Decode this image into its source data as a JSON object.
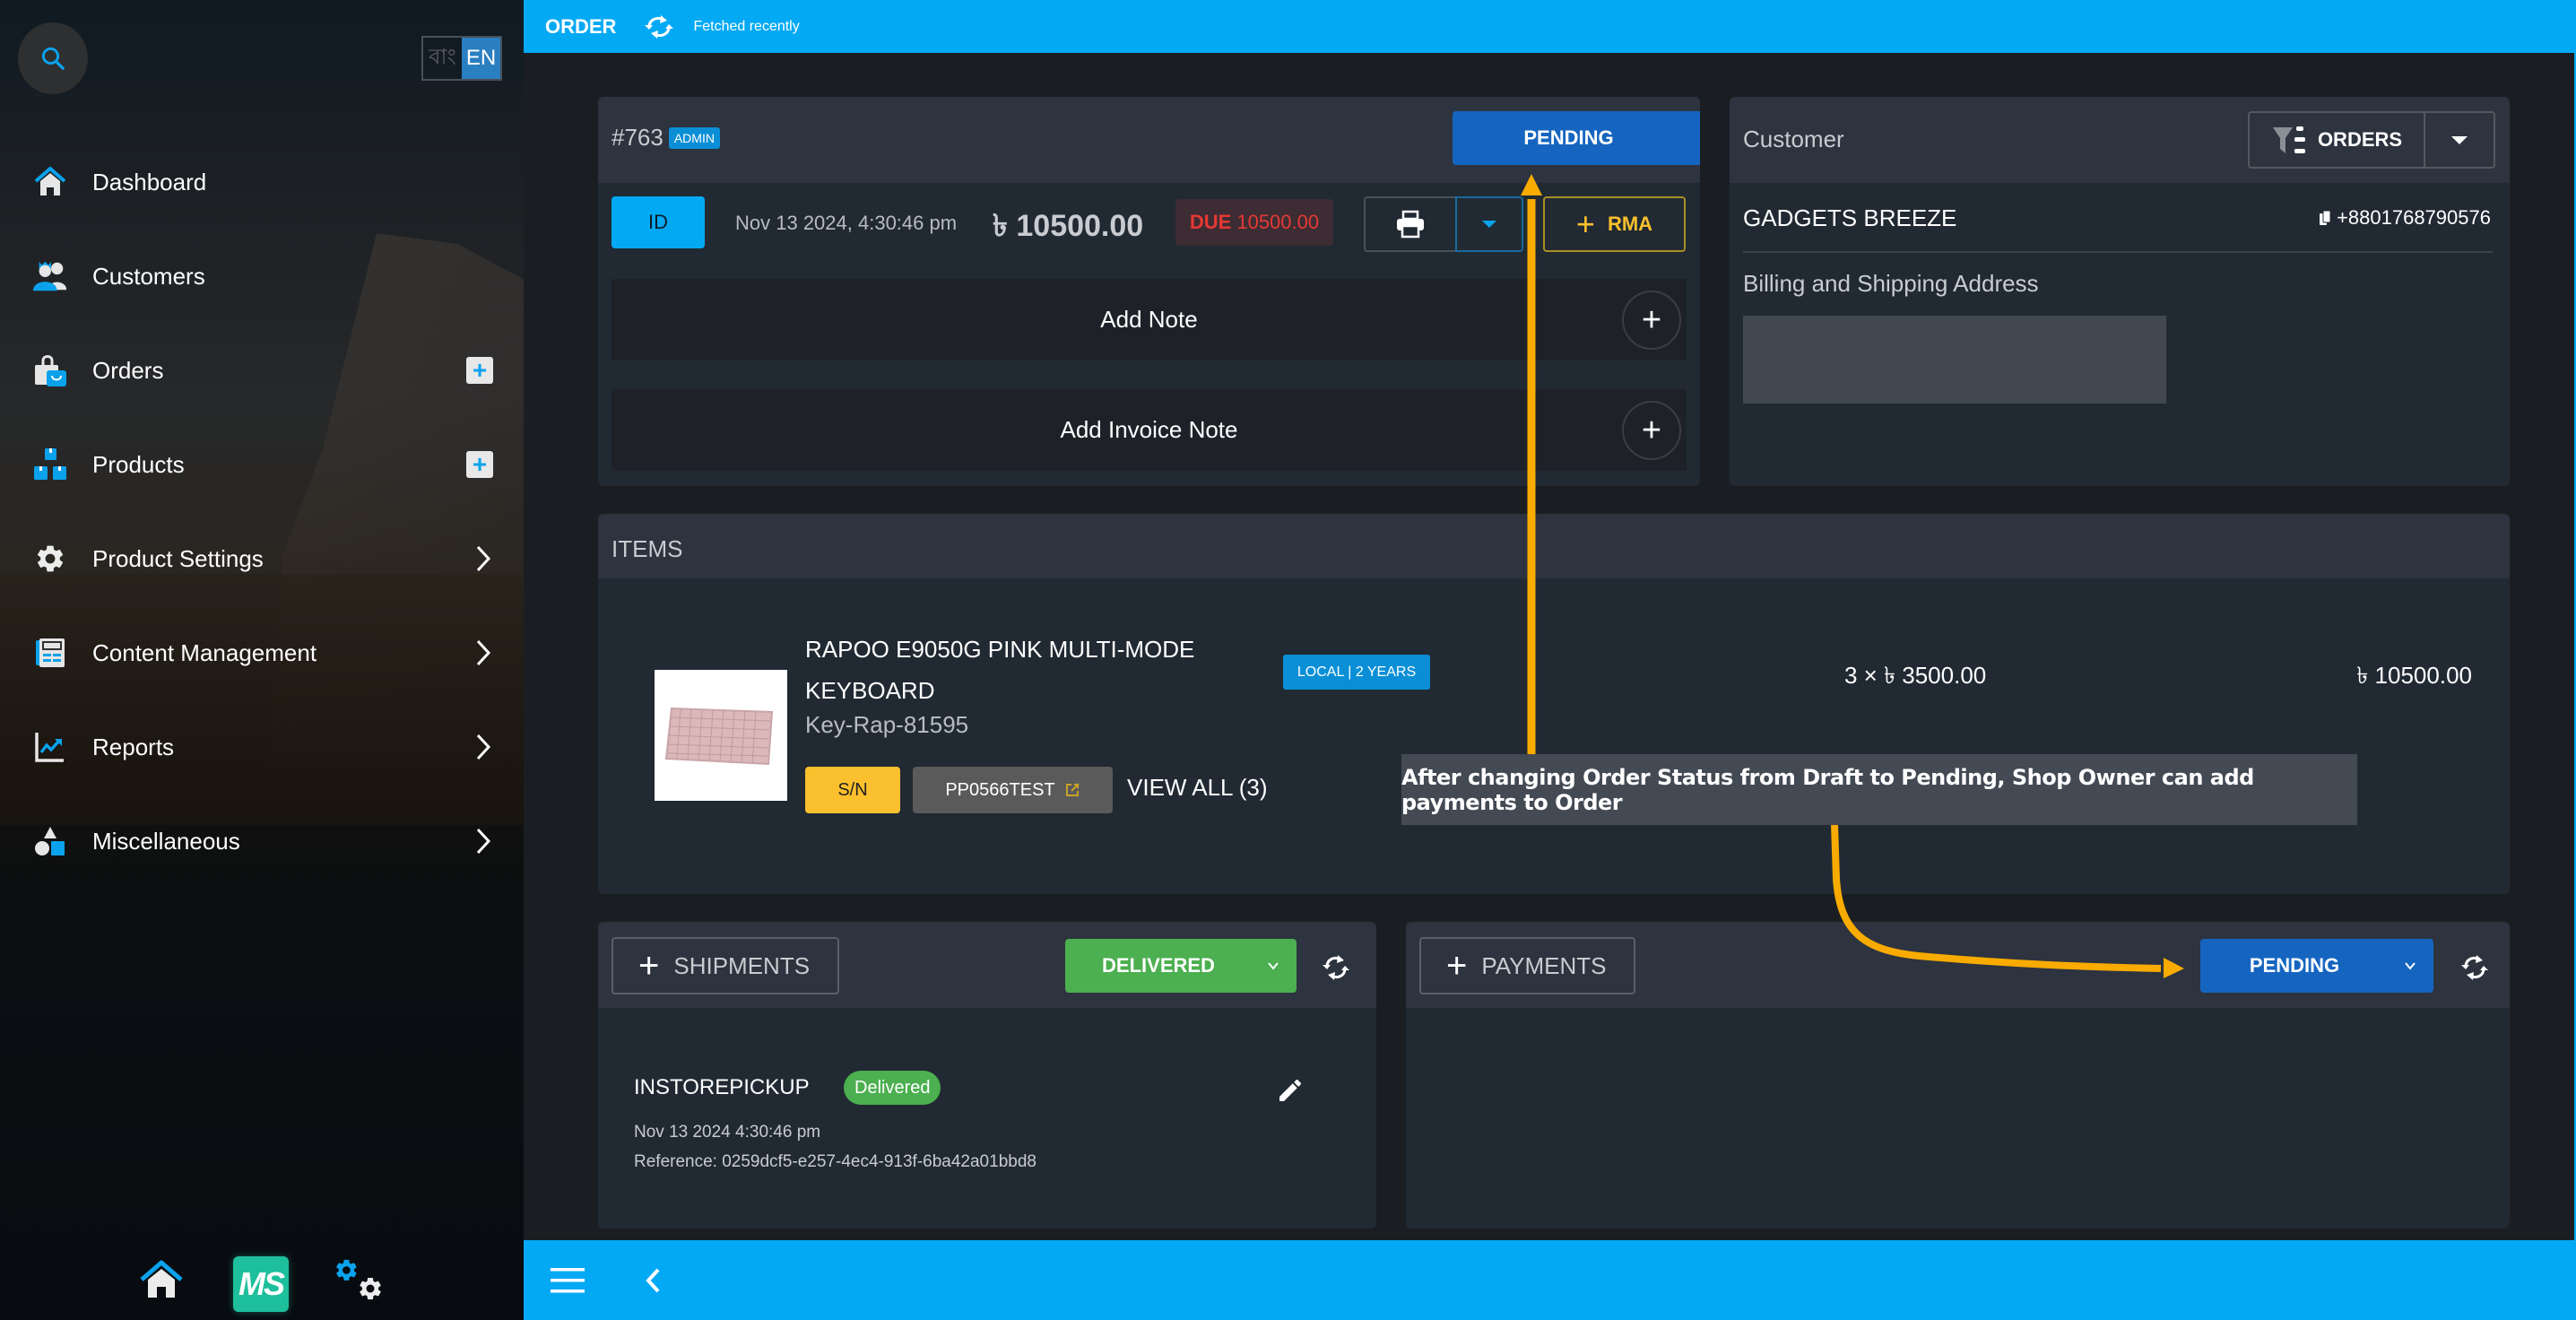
{
  "sidebar": {
    "search_icon": "search-icon",
    "language": {
      "bn": "বাং",
      "en": "EN",
      "active": "EN"
    },
    "items": [
      {
        "label": "Dashboard",
        "icon": "home-icon",
        "action": null
      },
      {
        "label": "Customers",
        "icon": "customers-icon",
        "action": null
      },
      {
        "label": "Orders",
        "icon": "orders-bag-icon",
        "action": "add"
      },
      {
        "label": "Products",
        "icon": "products-boxes-icon",
        "action": "add"
      },
      {
        "label": "Product Settings",
        "icon": "gear-icon",
        "action": "expand"
      },
      {
        "label": "Content Management",
        "icon": "content-icon",
        "action": "expand"
      },
      {
        "label": "Reports",
        "icon": "chart-icon",
        "action": "expand"
      },
      {
        "label": "Miscellaneous",
        "icon": "shapes-icon",
        "action": "expand"
      }
    ],
    "bottom": {
      "logo_text": "MS"
    }
  },
  "topbar": {
    "title": "ORDER",
    "status": "Fetched recently"
  },
  "order": {
    "number": "#763",
    "source_badge": "ADMIN",
    "status": "PENDING",
    "id_button": "ID",
    "date": "Nov 13 2024, 4:30:46 pm",
    "currency_symbol": "৳",
    "total": "৳ 10500.00",
    "due_label": "DUE",
    "due_amount": "10500.00",
    "rma_label": "RMA",
    "add_note": "Add Note",
    "add_invoice_note": "Add Invoice Note"
  },
  "customer": {
    "title": "Customer",
    "orders_button": "ORDERS",
    "name": "GADGETS BREEZE",
    "phone": "+8801768790576",
    "address_title": "Billing and Shipping Address"
  },
  "items": {
    "title": "ITEMS",
    "list": [
      {
        "name": "RAPOO E9050G PINK MULTI-MODE KEYBOARD",
        "sku": "Key-Rap-81595",
        "warranty": "LOCAL | 2 YEARS",
        "sn_label": "S/N",
        "serial": "PP0566TEST",
        "view_all": "VIEW ALL (3)",
        "qty_price": "3 × ৳ 3500.00",
        "line_total": "৳ 10500.00"
      }
    ]
  },
  "annotation": {
    "text": "After changing Order Status from Draft to Pending, Shop Owner can add payments to Order",
    "color": "#f9ab00"
  },
  "shipments": {
    "add_label": "SHIPMENTS",
    "status": "DELIVERED",
    "list": [
      {
        "method": "INSTOREPICKUP",
        "badge": "Delivered",
        "date": "Nov 13 2024 4:30:46 pm",
        "reference": "Reference: 0259dcf5-e257-4ec4-913f-6ba42a01bbd8"
      }
    ]
  },
  "payments": {
    "add_label": "PAYMENTS",
    "status": "PENDING"
  },
  "colors": {
    "accent": "#04a9f4",
    "pending": "#1565c0",
    "delivered": "#4caf50",
    "due": "#e53935",
    "rma": "#fbc02d"
  }
}
